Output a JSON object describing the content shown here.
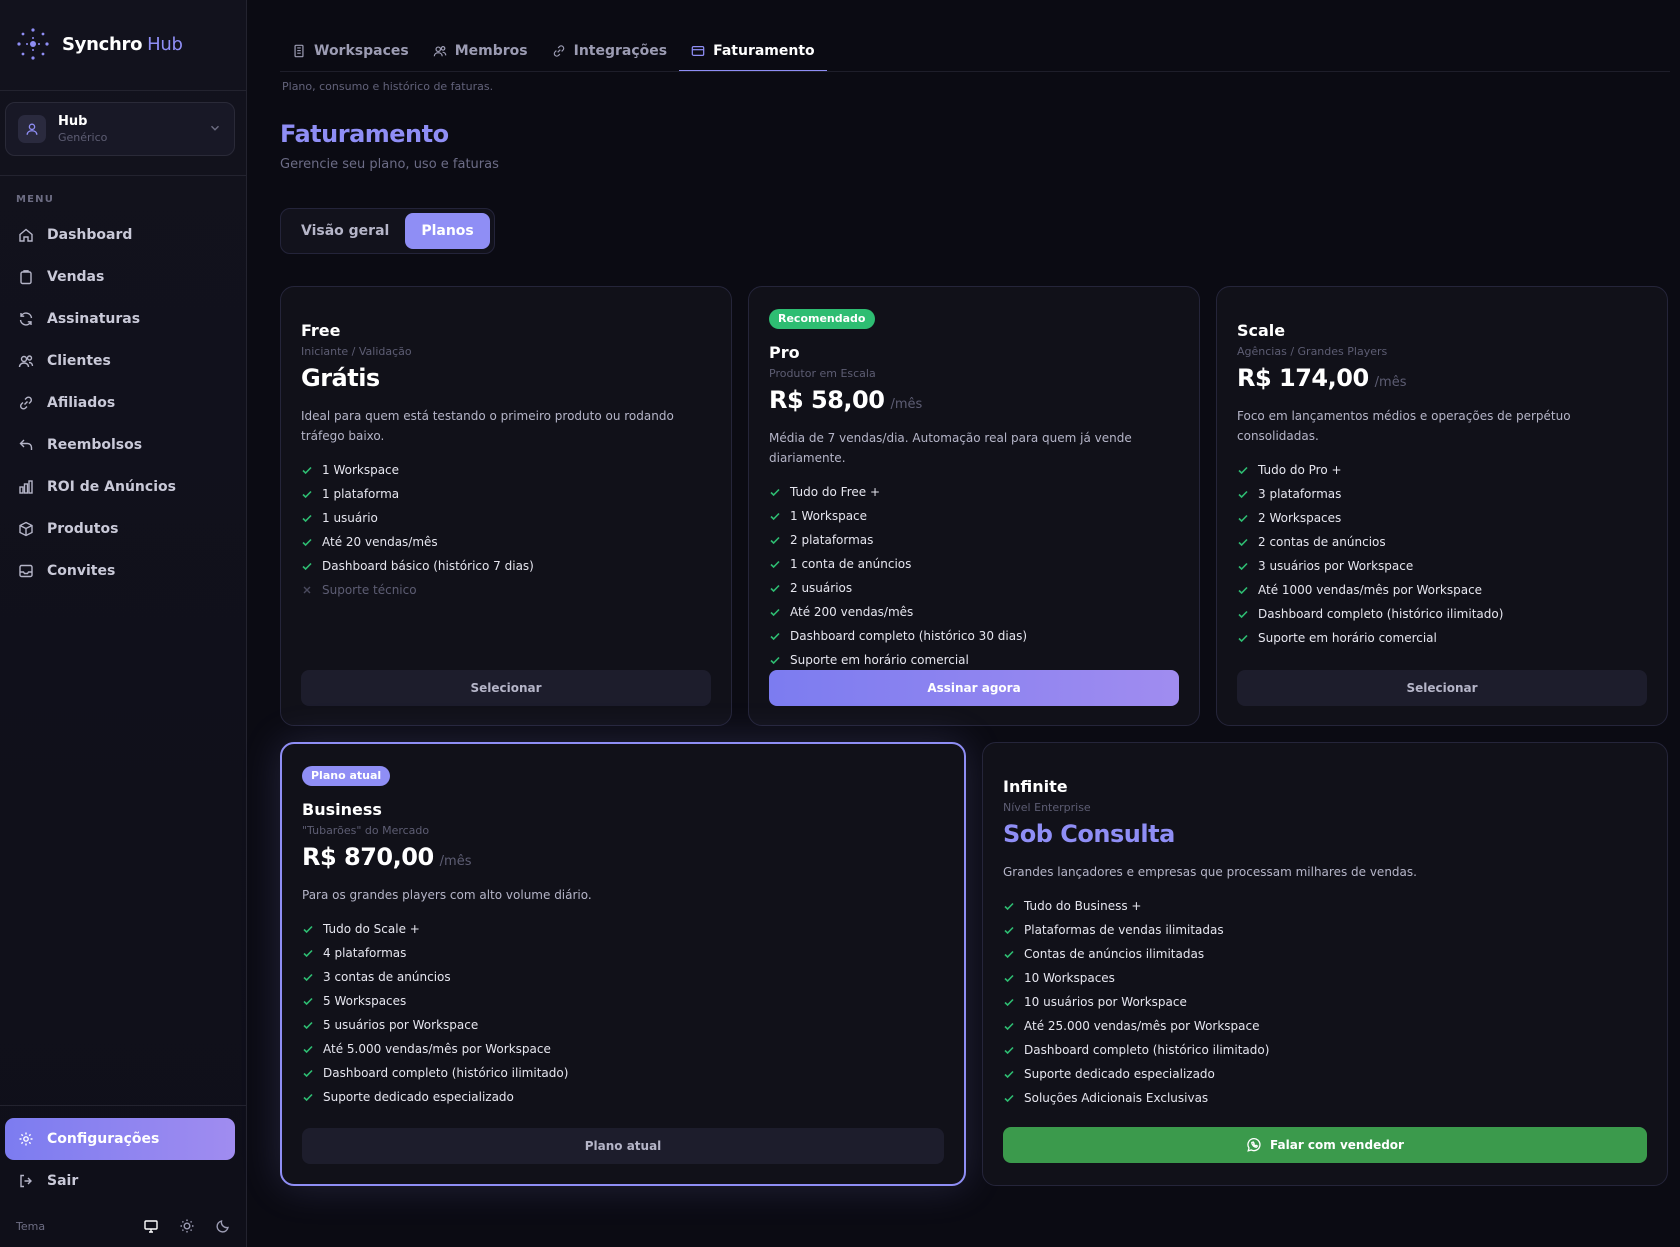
{
  "brand": {
    "name": "Synchro",
    "suffix": "Hub"
  },
  "workspace": {
    "name": "Hub",
    "sub": "Genérico"
  },
  "sidebar": {
    "menu_label": "MENU",
    "items": [
      {
        "label": "Dashboard"
      },
      {
        "label": "Vendas"
      },
      {
        "label": "Assinaturas"
      },
      {
        "label": "Clientes"
      },
      {
        "label": "Afiliados"
      },
      {
        "label": "Reembolsos"
      },
      {
        "label": "ROI de Anúncios"
      },
      {
        "label": "Produtos"
      },
      {
        "label": "Convites"
      }
    ],
    "settings_label": "Configurações",
    "logout_label": "Sair",
    "theme_label": "Tema"
  },
  "tabs": [
    {
      "label": "Workspaces"
    },
    {
      "label": "Membros"
    },
    {
      "label": "Integrações"
    },
    {
      "label": "Faturamento"
    }
  ],
  "page": {
    "breadcrumb": "Plano, consumo e histórico de faturas.",
    "title": "Faturamento",
    "subtitle": "Gerencie seu plano, uso e faturas",
    "segments": [
      {
        "label": "Visão geral"
      },
      {
        "label": "Planos"
      }
    ]
  },
  "colors": {
    "accent": "#8f8ef5",
    "success": "#2ebd72",
    "whatsapp": "#3b9a4c",
    "background": "#0b0b13"
  },
  "plans": {
    "free": {
      "name": "Free",
      "tag": "Iniciante / Validação",
      "price": "Grátis",
      "desc": "Ideal para quem está testando o primeiro produto ou rodando tráfego baixo.",
      "features": [
        "1 Workspace",
        "1 plataforma",
        "1 usuário",
        "Até 20 vendas/mês",
        "Dashboard básico (histórico 7 dias)",
        "Suporte técnico"
      ],
      "button": "Selecionar"
    },
    "pro": {
      "badge": "Recomendado",
      "name": "Pro",
      "tag": "Produtor em Escala",
      "price": "R$ 58,00",
      "per": "/mês",
      "desc": "Média de 7 vendas/dia. Automação real para quem já vende diariamente.",
      "features": [
        "Tudo do Free +",
        "1 Workspace",
        "2 plataformas",
        "1 conta de anúncios",
        "2 usuários",
        "Até 200 vendas/mês",
        "Dashboard completo (histórico 30 dias)",
        "Suporte em horário comercial"
      ],
      "button": "Assinar agora"
    },
    "scale": {
      "name": "Scale",
      "tag": "Agências / Grandes Players",
      "price": "R$ 174,00",
      "per": "/mês",
      "desc": "Foco em lançamentos médios e operações de perpétuo consolidadas.",
      "features": [
        "Tudo do Pro +",
        "3 plataformas",
        "2 Workspaces",
        "2 contas de anúncios",
        "3 usuários por Workspace",
        "Até 1000 vendas/mês por Workspace",
        "Dashboard completo (histórico ilimitado)",
        "Suporte em horário comercial"
      ],
      "button": "Selecionar"
    },
    "business": {
      "badge": "Plano atual",
      "name": "Business",
      "tag": "\"Tubarões\" do Mercado",
      "price": "R$ 870,00",
      "per": "/mês",
      "desc": "Para os grandes players com alto volume diário.",
      "features": [
        "Tudo do Scale +",
        "4 plataformas",
        "3 contas de anúncios",
        "5 Workspaces",
        "5 usuários por Workspace",
        "Até 5.000 vendas/mês por Workspace",
        "Dashboard completo (histórico ilimitado)",
        "Suporte dedicado especializado"
      ],
      "button": "Plano atual"
    },
    "infinite": {
      "name": "Infinite",
      "tag": "Nível Enterprise",
      "price": "Sob Consulta",
      "desc": "Grandes lançadores e empresas que processam milhares de vendas.",
      "features": [
        "Tudo do Business +",
        "Plataformas de vendas ilimitadas",
        "Contas de anúncios ilimitadas",
        "10 Workspaces",
        "10 usuários por Workspace",
        "Até 25.000 vendas/mês por Workspace",
        "Dashboard completo (histórico ilimitado)",
        "Suporte dedicado especializado",
        "Soluções Adicionais Exclusivas"
      ],
      "button": "Falar com vendedor"
    }
  }
}
